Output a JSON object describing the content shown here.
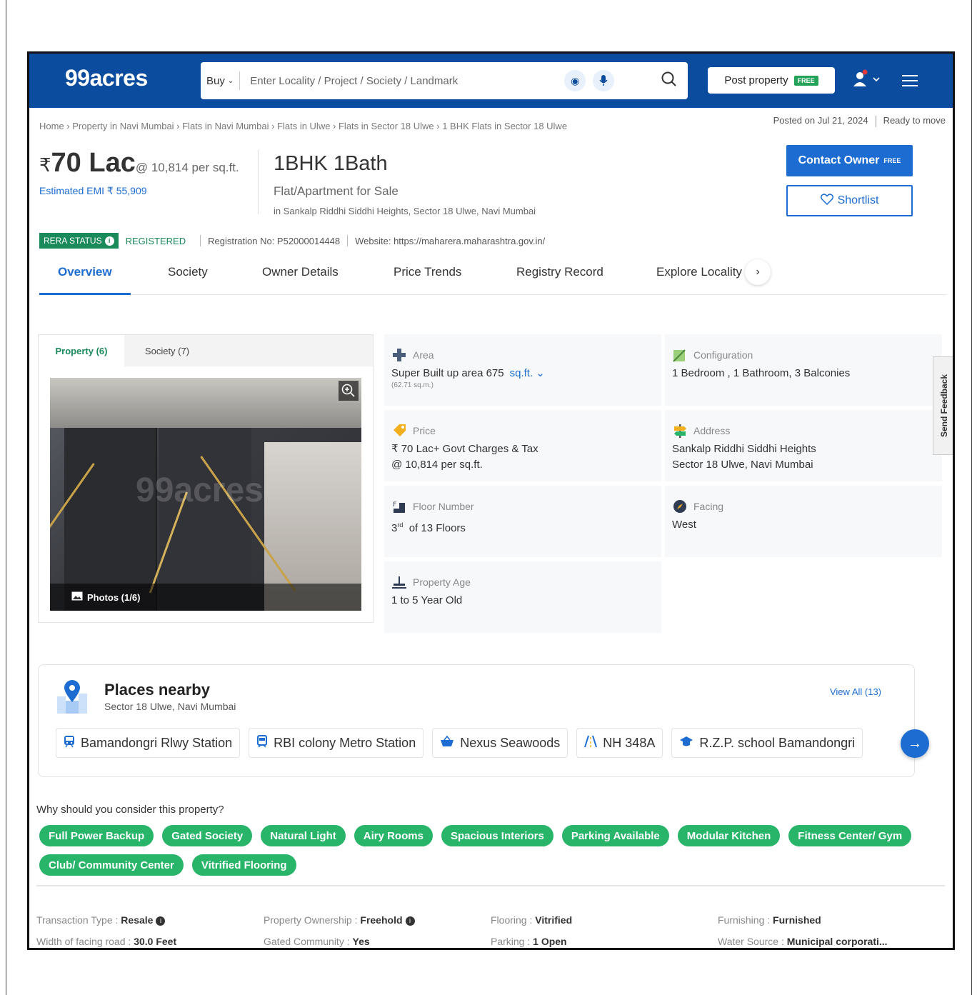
{
  "header": {
    "logo": "99acres",
    "buy_label": "Buy",
    "search_placeholder": "Enter Locality / Project / Society / Landmark",
    "post_property": "Post property",
    "free_tag": "FREE"
  },
  "breadcrumb": "Home › Property in Navi Mumbai › Flats in Navi Mumbai › Flats in Ulwe › Flats in Sector 18 Ulwe › 1 BHK Flats in Sector 18 Ulwe",
  "posted": "Posted on Jul 21, 2024",
  "ready": "Ready to move",
  "listing": {
    "rupee": "₹",
    "price": "70 Lac",
    "per_sqft": "@ 10,814 per sq.ft.",
    "emi": "Estimated EMI ₹ 55,909",
    "title": "1BHK 1Bath",
    "subtitle": "Flat/Apartment for Sale",
    "location": "in Sankalp Riddhi Siddhi Heights, Sector 18 Ulwe, Navi Mumbai"
  },
  "actions": {
    "contact": "Contact Owner",
    "contact_free": "FREE",
    "shortlist": "Shortlist"
  },
  "rera": {
    "status": "RERA STATUS",
    "registered": "REGISTERED",
    "reg_no": "Registration No: P52000014448",
    "website": "Website: https://maharera.maharashtra.gov.in/"
  },
  "tabs": [
    "Overview",
    "Society",
    "Owner Details",
    "Price Trends",
    "Registry Record",
    "Explore Locality"
  ],
  "gallery": {
    "tab_property": "Property (6)",
    "tab_society": "Society (7)",
    "photos": "Photos (1/6)",
    "watermark": "99acres"
  },
  "details": {
    "area_label": "Area",
    "area_value": "Super Built up area 675",
    "area_unit": "sq.ft.",
    "area_sqm": "(62.71 sq.m.)",
    "config_label": "Configuration",
    "config_value": "1 Bedroom , 1 Bathroom, 3 Balconies",
    "price_label": "Price",
    "price_value1": "₹ 70 Lac+ Govt Charges & Tax",
    "price_value2": "@ 10,814 per sq.ft.",
    "address_label": "Address",
    "address_value1": "Sankalp Riddhi Siddhi Heights",
    "address_value2": "Sector 18 Ulwe, Navi Mumbai",
    "floor_label": "Floor Number",
    "floor_value_num": "3",
    "floor_value_sup": "rd",
    "floor_value_rest": "of 13 Floors",
    "facing_label": "Facing",
    "facing_value": "West",
    "age_label": "Property Age",
    "age_value": "1 to 5 Year Old"
  },
  "feedback": "Send Feedback",
  "places": {
    "title": "Places nearby",
    "subtitle": "Sector 18 Ulwe, Navi Mumbai",
    "view_all": "View All (13)",
    "chips": [
      {
        "label": "Bamandongri Rlwy Station",
        "icon": "train-icon"
      },
      {
        "label": "RBI colony Metro Station",
        "icon": "metro-icon"
      },
      {
        "label": "Nexus Seawoods",
        "icon": "shopping-icon"
      },
      {
        "label": "NH 348A",
        "icon": "road-icon"
      },
      {
        "label": "R.Z.P. school Bamandongri",
        "icon": "school-icon"
      }
    ]
  },
  "why": {
    "title": "Why should you consider this property?",
    "pills": [
      "Full Power Backup",
      "Gated Society",
      "Natural Light",
      "Airy Rooms",
      "Spacious Interiors",
      "Parking Available",
      "Modular Kitchen",
      "Fitness Center/ Gym",
      "Club/ Community Center",
      "Vitrified Flooring"
    ]
  },
  "facts": {
    "transaction_label": "Transaction Type : ",
    "transaction_value": "Resale",
    "road_label": "Width of facing road : ",
    "road_value": "30.0 Feet",
    "ownership_label": "Property Ownership : ",
    "ownership_value": "Freehold",
    "gated_label": "Gated Community : ",
    "gated_value": "Yes",
    "flooring_label": "Flooring : ",
    "flooring_value": "Vitrified",
    "parking_label": "Parking : ",
    "parking_value": "1 Open",
    "furnishing_label": "Furnishing : ",
    "furnishing_value": "Furnished",
    "water_label": "Water Source : ",
    "water_value": "Municipal corporati..."
  },
  "colors": {
    "brand_blue": "#0b4c9e",
    "accent_blue": "#1c6cd1",
    "green": "#28b469"
  }
}
